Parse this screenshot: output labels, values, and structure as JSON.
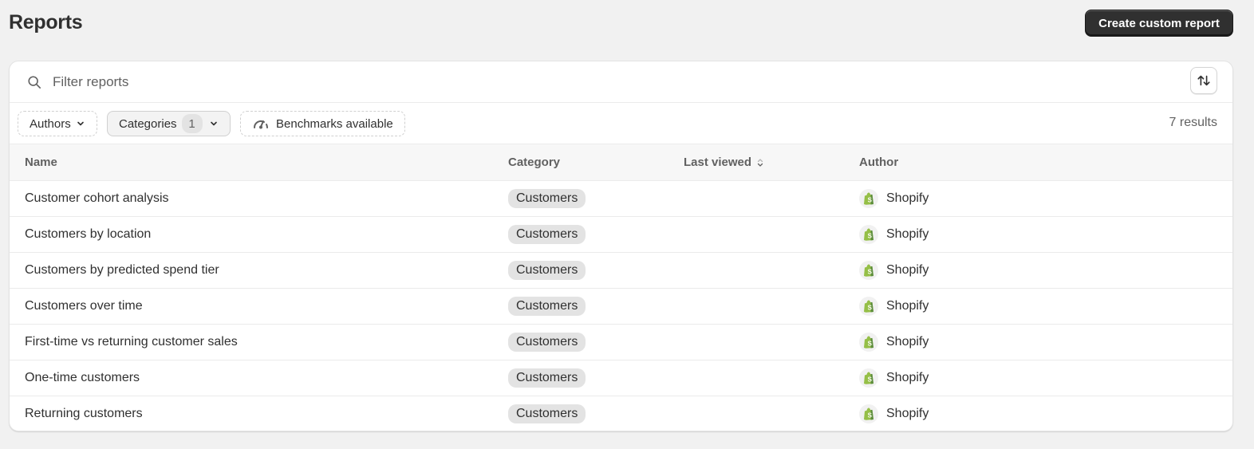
{
  "header": {
    "title": "Reports",
    "create_button": "Create custom report"
  },
  "search": {
    "placeholder": "Filter reports",
    "value": ""
  },
  "filters": {
    "authors": "Authors",
    "categories": "Categories",
    "categories_count": "1",
    "benchmarks": "Benchmarks available",
    "results": "7 results"
  },
  "table": {
    "columns": {
      "name": "Name",
      "category": "Category",
      "last_viewed": "Last viewed",
      "author": "Author"
    },
    "rows": [
      {
        "name": "Customer cohort analysis",
        "category": "Customers",
        "last_viewed": "",
        "author": "Shopify"
      },
      {
        "name": "Customers by location",
        "category": "Customers",
        "last_viewed": "",
        "author": "Shopify"
      },
      {
        "name": "Customers by predicted spend tier",
        "category": "Customers",
        "last_viewed": "",
        "author": "Shopify"
      },
      {
        "name": "Customers over time",
        "category": "Customers",
        "last_viewed": "",
        "author": "Shopify"
      },
      {
        "name": "First-time vs returning customer sales",
        "category": "Customers",
        "last_viewed": "",
        "author": "Shopify"
      },
      {
        "name": "One-time customers",
        "category": "Customers",
        "last_viewed": "",
        "author": "Shopify"
      },
      {
        "name": "Returning customers",
        "category": "Customers",
        "last_viewed": "",
        "author": "Shopify"
      }
    ]
  },
  "colors": {
    "primary_button": "#303030",
    "shopify_green": "#95bf47",
    "badge_bg": "#e3e3e3"
  }
}
